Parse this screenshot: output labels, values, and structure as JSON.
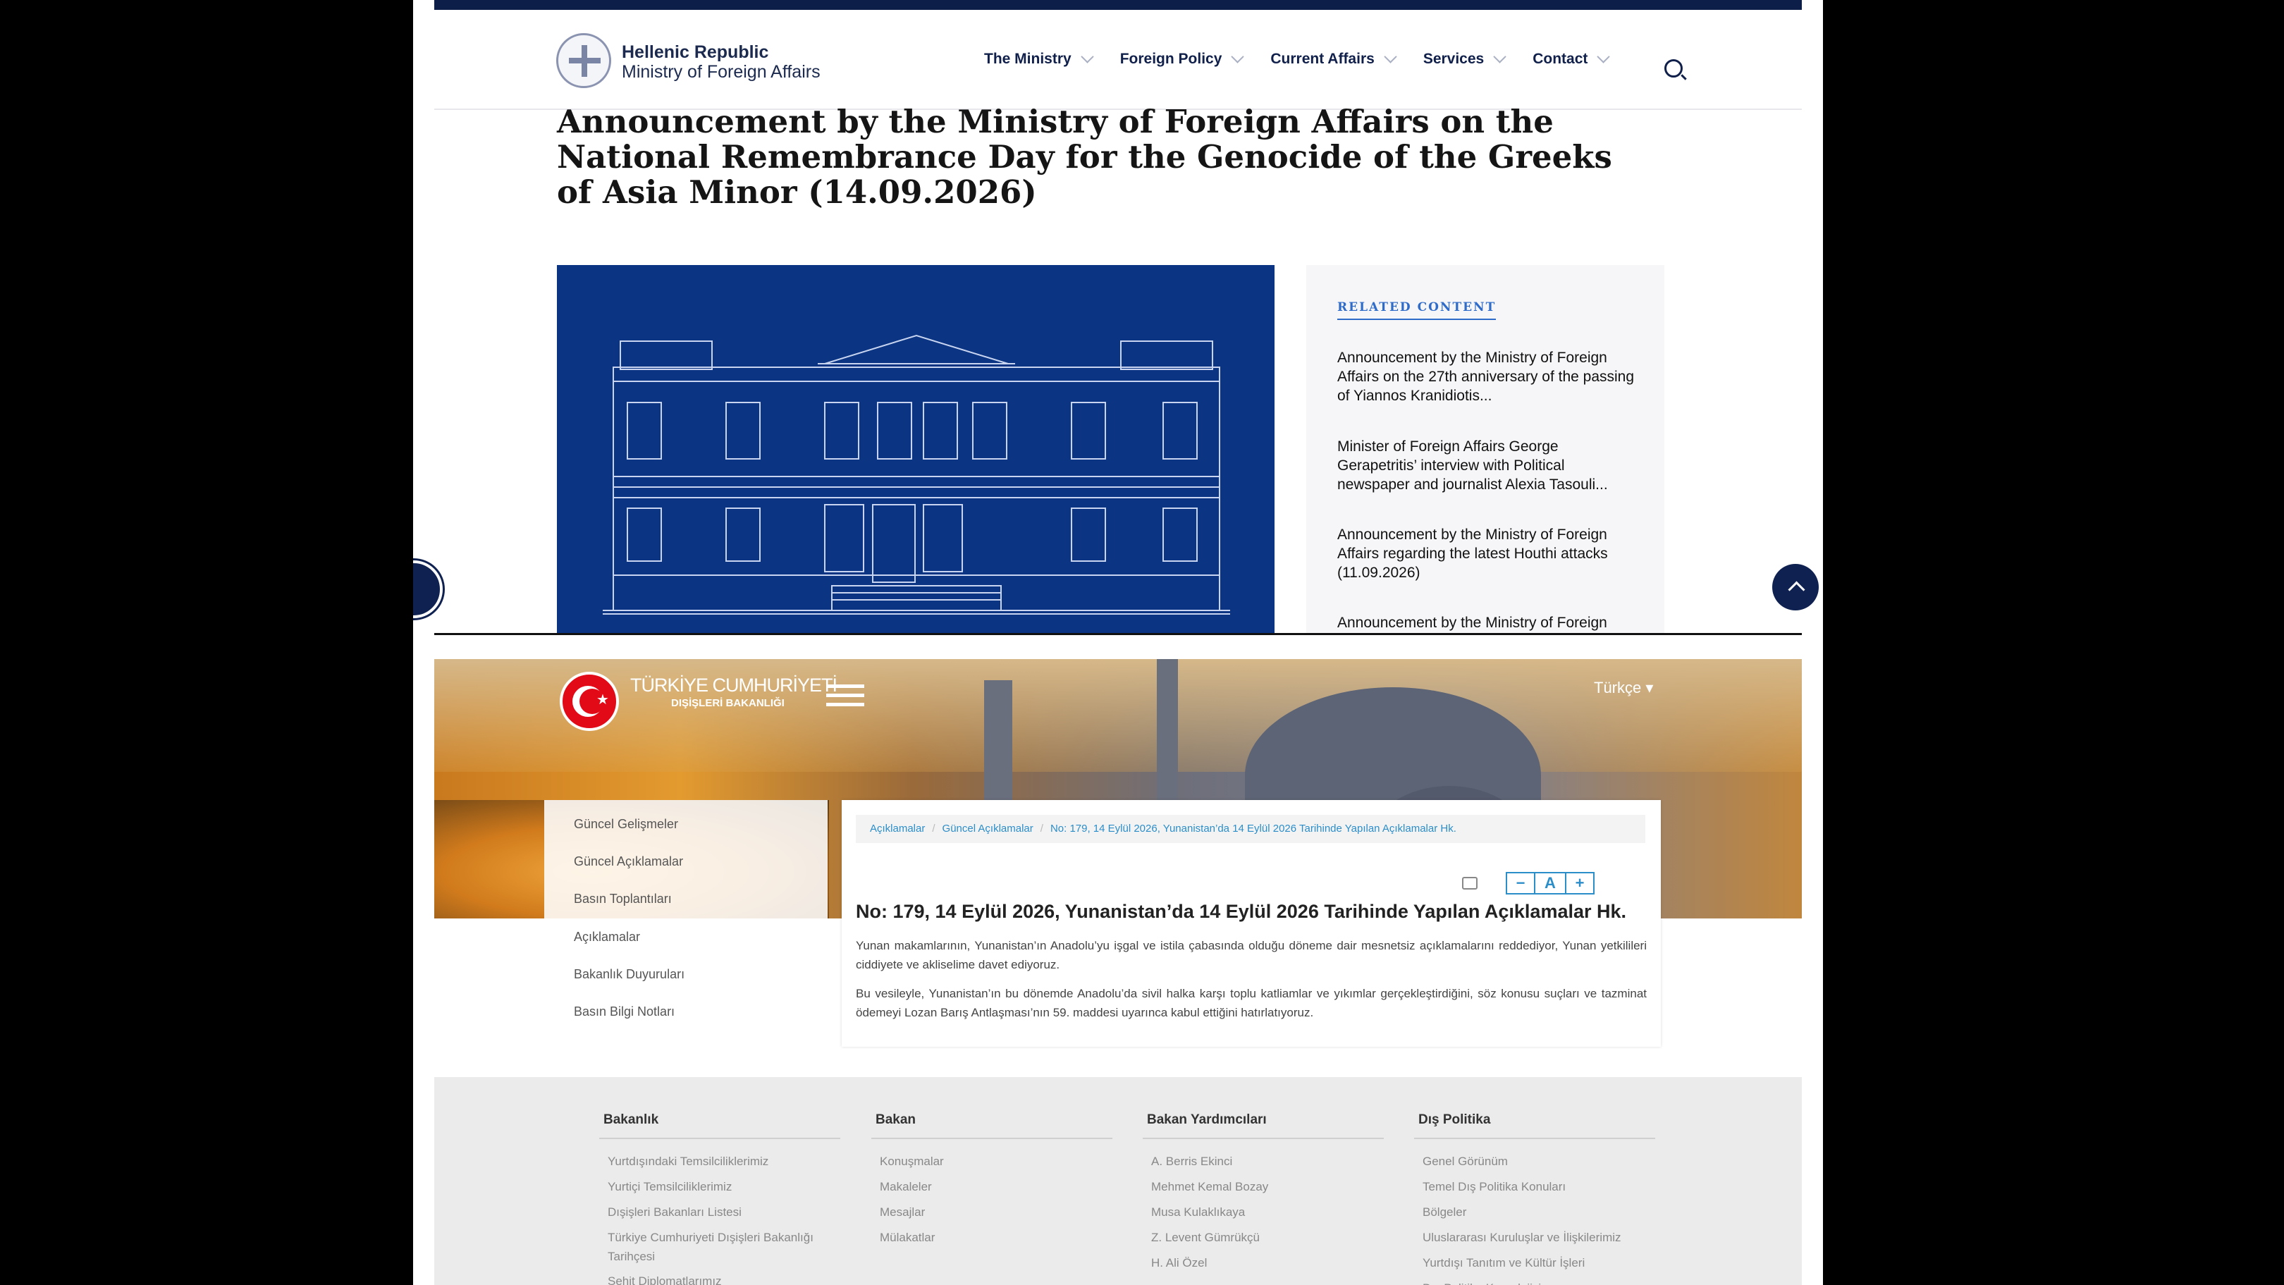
{
  "greek": {
    "logo_title": "Hellenic Republic",
    "logo_subtitle": "Ministry of Foreign Affairs",
    "nav": [
      "The Ministry",
      "Foreign Policy",
      "Current Affairs",
      "Services",
      "Contact"
    ],
    "headline": "Announcement by the Ministry of Foreign Affairs on the National Remembrance Day for the Genocide of the Greeks of Asia Minor (14.09.2026)",
    "related_title": "RELATED CONTENT",
    "related": [
      "Announcement by the Ministry of Foreign Affairs on the 27th anniversary of the passing of Yiannos Kranidiotis...",
      "Minister of Foreign Affairs George Gerapetritis’ interview with Political newspaper and journalist Alexia Tasouli...",
      "Announcement by the Ministry of Foreign Affairs regarding the latest Houthi attacks (11.09.2026)",
      "Announcement by the Ministry of Foreign"
    ],
    "colors": {
      "navy": "#0d1e48",
      "hero": "#0b3582",
      "accent": "#2f6bc8"
    }
  },
  "turkish": {
    "brand_line1": "TÜRKİYE CUMHURİYETİ",
    "brand_line2": "DIŞİŞLERİ BAKANLIĞI",
    "language": "Türkçe",
    "sidebar": [
      "Güncel Gelişmeler",
      "Güncel Açıklamalar",
      "Basın Toplantıları",
      "Açıklamalar",
      "Bakanlık Duyuruları",
      "Basın Bilgi Notları"
    ],
    "breadcrumb": [
      "Açıklamalar",
      "Güncel Açıklamalar",
      "No: 179, 14 Eylül 2026, Yunanistan’da 14 Eylül 2026 Tarihinde Yapılan Açıklamalar Hk."
    ],
    "font_controls": [
      "−",
      "A",
      "+"
    ],
    "title": "No: 179, 14 Eylül 2026, Yunanistan’da 14 Eylül 2026 Tarihinde Yapılan Açıklamalar Hk.",
    "paragraphs": [
      "Yunan makamlarının, Yunanistan’ın Anadolu’yu işgal ve istila çabasında olduğu döneme dair mesnetsiz açıklamalarını reddediyor, Yunan yetkilileri ciddiyete ve akliselime davet ediyoruz.",
      "Bu vesileyle, Yunanistan’ın bu dönemde Anadolu’da sivil halka karşı toplu katliamlar ve yıkımlar gerçekleştirdiğini, söz konusu suçları ve tazminat ödemeyi Lozan Barış Antlaşması’nın 59. maddesi uyarınca kabul ettiğini hatırlatıyoruz."
    ],
    "footer": [
      {
        "heading": "Bakanlık",
        "links": [
          "Yurtdışındaki Temsilciliklerimiz",
          "Yurtiçi Temsilciliklerimiz",
          "Dışişleri Bakanları Listesi",
          "Türkiye Cumhuriyeti Dışişleri Bakanlığı Tarihçesi",
          "Şehit Diplomatlarımız"
        ]
      },
      {
        "heading": "Bakan",
        "links": [
          "Konuşmalar",
          "Makaleler",
          "Mesajlar",
          "Mülakatlar"
        ]
      },
      {
        "heading": "Bakan Yardımcıları",
        "links": [
          "A. Berris Ekinci",
          "Mehmet Kemal Bozay",
          "Musa Kulaklıkaya",
          "Z. Levent Gümrükçü",
          "H. Ali Özel"
        ]
      },
      {
        "heading": "Dış Politika",
        "links": [
          "Genel Görünüm",
          "Temel Dış Politika Konuları",
          "Bölgeler",
          "Uluslararası Kuruluşlar ve İlişkilerimiz",
          "Yurtdışı Tanıtım ve Kültür İşleri",
          "Dış Politika Kronolojisi"
        ]
      }
    ],
    "colors": {
      "red": "#e30a17",
      "link": "#2c8ec9"
    }
  }
}
